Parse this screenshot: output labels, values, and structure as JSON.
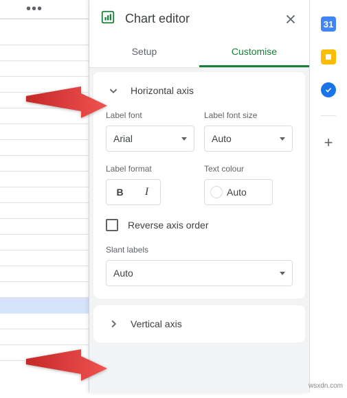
{
  "panel": {
    "title": "Chart editor",
    "tab_setup": "Setup",
    "tab_customise": "Customise"
  },
  "haxis": {
    "title": "Horizontal axis",
    "label_font_label": "Label font",
    "label_font_value": "Arial",
    "label_font_size_label": "Label font size",
    "label_font_size_value": "Auto",
    "label_format_label": "Label format",
    "text_colour_label": "Text colour",
    "text_colour_value": "Auto",
    "reverse_label": "Reverse axis order",
    "slant_label": "Slant labels",
    "slant_value": "Auto"
  },
  "vaxis": {
    "title": "Vertical axis"
  },
  "watermark": "wsxdn.com"
}
